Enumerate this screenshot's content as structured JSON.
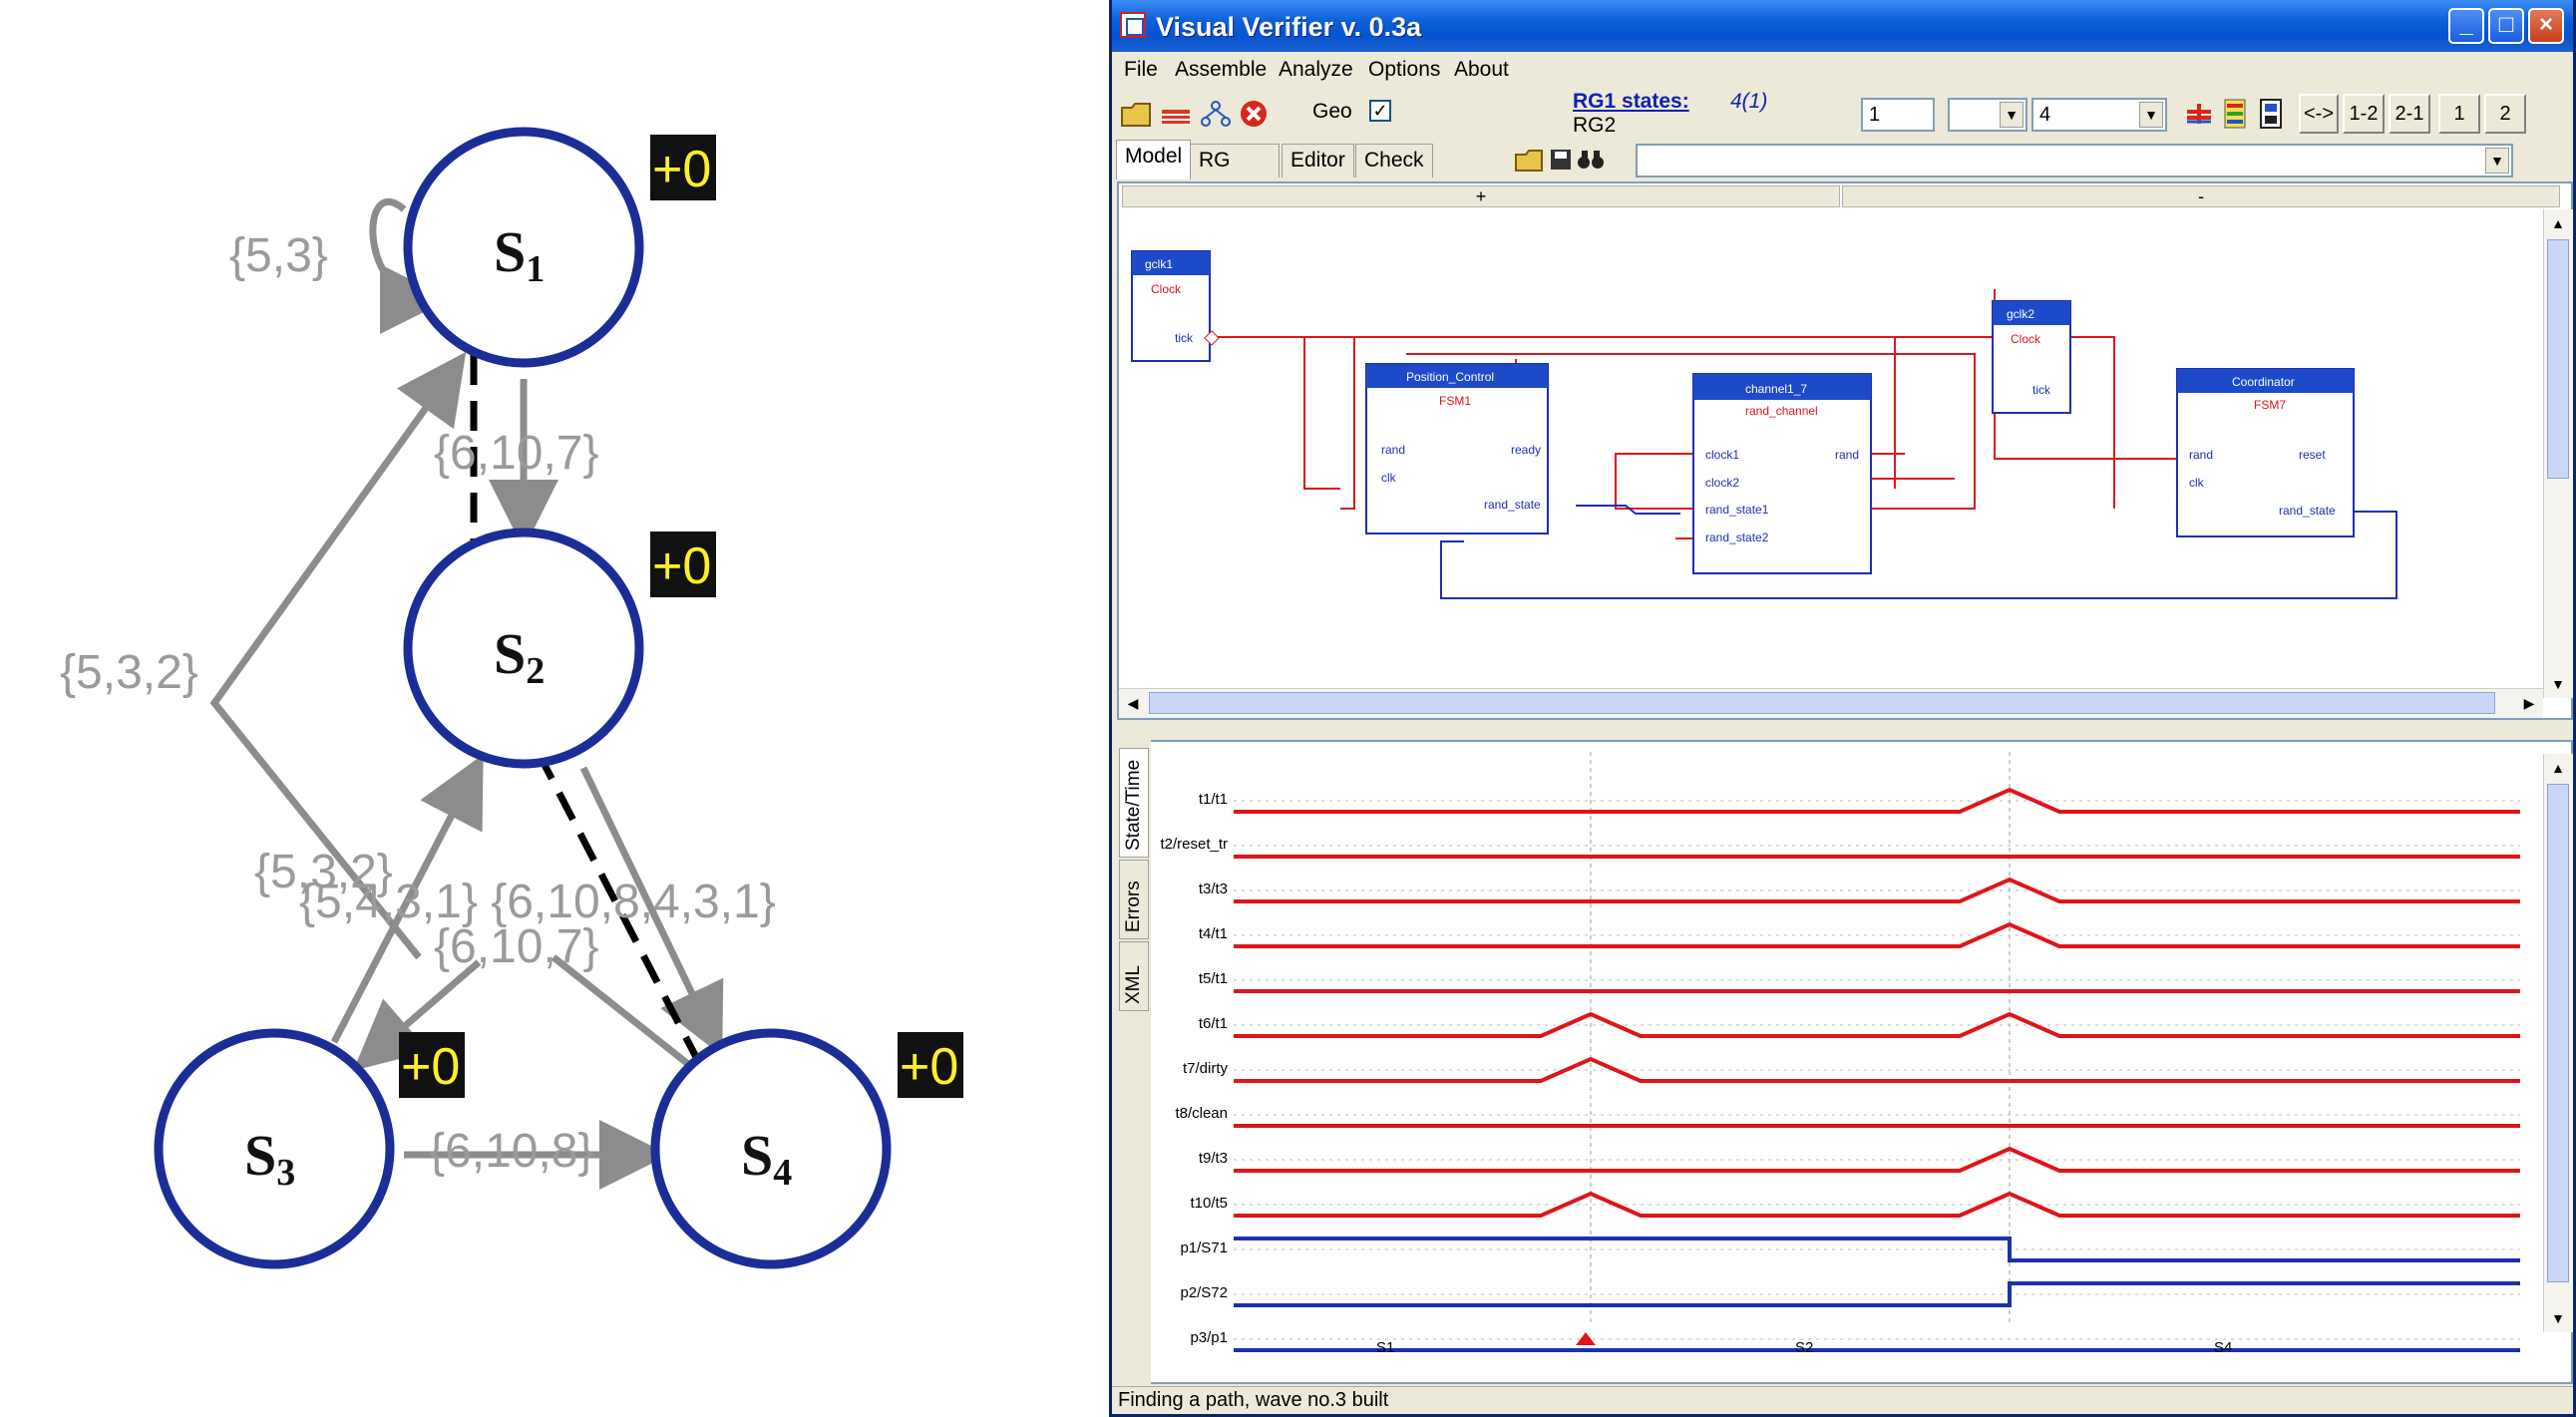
{
  "graph": {
    "nodes": [
      {
        "name": "S",
        "sub": "1",
        "badge": "+0"
      },
      {
        "name": "S",
        "sub": "2",
        "badge": "+0"
      },
      {
        "name": "S",
        "sub": "3",
        "badge": "+0"
      },
      {
        "name": "S",
        "sub": "4",
        "badge": "+0"
      }
    ],
    "edge_labels": {
      "s1_self": "{5,3}",
      "s1_s2": "{6,10,7}",
      "s3_s1": "{5,3,2}",
      "s3_s2": "{5,3,2}",
      "s2_s4_overlap": "{5,4,3,1} {6,10,8,4,3,1}",
      "s2_s3": "{6,10,7}",
      "s3_s4": "{6,10,8}"
    },
    "colors": {
      "node": "#1b2d96",
      "edge": "#8c8c8c",
      "path": "#000000",
      "badge_bg": "#111111",
      "badge_fg": "#ffef2a"
    }
  },
  "window": {
    "title": "Visual Verifier v. 0.3a",
    "menu": [
      "File",
      "Assemble",
      "Analyze",
      "Options",
      "About"
    ],
    "toolbar": {
      "geo_label": "Geo",
      "geo_checked": "✓",
      "rg1_label": "RG1 states:",
      "rg1_value": "4(1)",
      "rg2_label": "RG2",
      "field1": "1",
      "field2": "",
      "field3": "4",
      "buttons": [
        "<->",
        "1-2",
        "2-1",
        "1",
        "2"
      ]
    },
    "tabs": [
      "Model",
      "RG",
      "Editor",
      "Check"
    ],
    "splitter": {
      "plus": "+",
      "minus": "-"
    },
    "blocks": {
      "gclk1": {
        "title": "gclk1",
        "type": "Clock",
        "port": "tick"
      },
      "gclk2": {
        "title": "gclk2",
        "type": "Clock",
        "port": "tick"
      },
      "position": {
        "title": "Position_Control",
        "type": "FSM1",
        "in": [
          "rand",
          "clk"
        ],
        "out": [
          "ready",
          "rand_state"
        ]
      },
      "channel": {
        "title": "channel1_7",
        "type": "rand_channel",
        "in": [
          "clock1",
          "clock2",
          "rand_state1",
          "rand_state2"
        ],
        "out": [
          "rand"
        ]
      },
      "coordinator": {
        "title": "Coordinator",
        "type": "FSM7",
        "in": [
          "rand",
          "clk"
        ],
        "out": [
          "reset",
          "rand_state"
        ]
      }
    },
    "side_tabs": [
      "State/Time",
      "Errors",
      "XML"
    ],
    "signals": [
      {
        "label": "t1/t1",
        "kind": "red",
        "pulses": [
          3
        ]
      },
      {
        "label": "t2/reset_tr",
        "kind": "red",
        "pulses": []
      },
      {
        "label": "t3/t3",
        "kind": "red",
        "pulses": [
          3
        ]
      },
      {
        "label": "t4/t1",
        "kind": "red",
        "pulses": [
          3
        ]
      },
      {
        "label": "t5/t1",
        "kind": "red",
        "pulses": []
      },
      {
        "label": "t6/t1",
        "kind": "red",
        "pulses": [
          2,
          3
        ]
      },
      {
        "label": "t7/dirty",
        "kind": "red",
        "pulses": [
          2
        ]
      },
      {
        "label": "t8/clean",
        "kind": "red",
        "pulses": []
      },
      {
        "label": "t9/t3",
        "kind": "red",
        "pulses": [
          3
        ]
      },
      {
        "label": "t10/t5",
        "kind": "red",
        "pulses": [
          2,
          3
        ]
      },
      {
        "label": "p1/S71",
        "kind": "blue",
        "level_start": 1,
        "level_end": 0
      },
      {
        "label": "p2/S72",
        "kind": "blue",
        "level_start": 0,
        "level_end": 1
      },
      {
        "label": "p3/p1",
        "kind": "blue",
        "level_start": 0,
        "level_end": 0
      }
    ],
    "time_states": [
      "S1",
      "S2",
      "S4"
    ],
    "status": "Finding a path, wave no.3 built"
  }
}
